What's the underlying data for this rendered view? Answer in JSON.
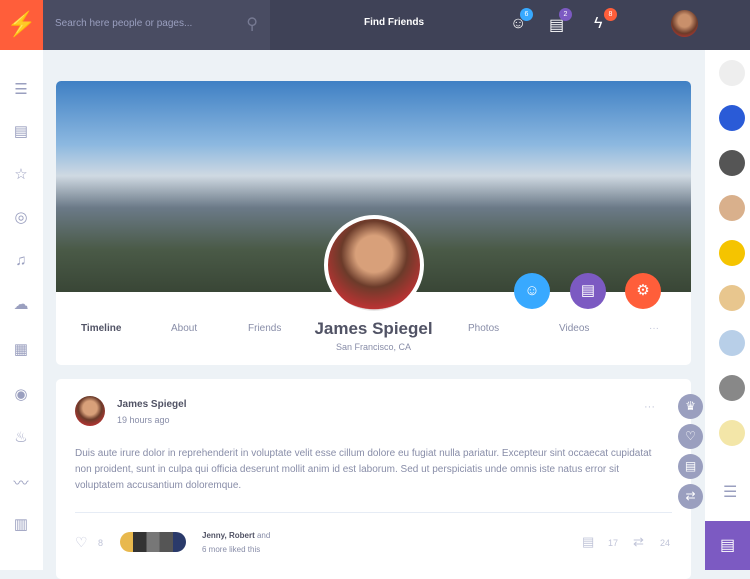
{
  "header": {
    "search_placeholder": "Search here people or pages...",
    "find_friends": "Find Friends",
    "notifications": [
      {
        "icon": "smiley-icon",
        "count": "6",
        "color": "#38a9ff"
      },
      {
        "icon": "chat-icon",
        "count": "2",
        "color": "#7c5ac2"
      },
      {
        "icon": "thunder-icon",
        "count": "8",
        "color": "#ff5e3a"
      }
    ]
  },
  "profile": {
    "name": "James Spiegel",
    "location": "San Francisco, CA",
    "tabs": [
      "Timeline",
      "About",
      "Friends",
      "Photos",
      "Videos"
    ],
    "more": "···"
  },
  "post": {
    "author": "James Spiegel",
    "time": "19 hours ago",
    "more": "···",
    "text": "Duis aute irure dolor in reprehenderit in voluptate velit esse cillum dolore eu fugiat nulla pariatur. Excepteur sint occaecat cupidatat non proident, sunt in culpa qui officia deserunt mollit anim id est laborum. Sed ut perspiciatis unde omnis iste natus error sit voluptatem accusantium doloremque.",
    "likes": "8",
    "liked_names": "Jenny, Robert",
    "liked_and": " and",
    "liked_more": "6 more liked this",
    "comments": "17",
    "shares": "24"
  },
  "colors": {
    "accent": "#ff5e3a",
    "blue": "#38a9ff",
    "purple": "#7c5ac2"
  }
}
